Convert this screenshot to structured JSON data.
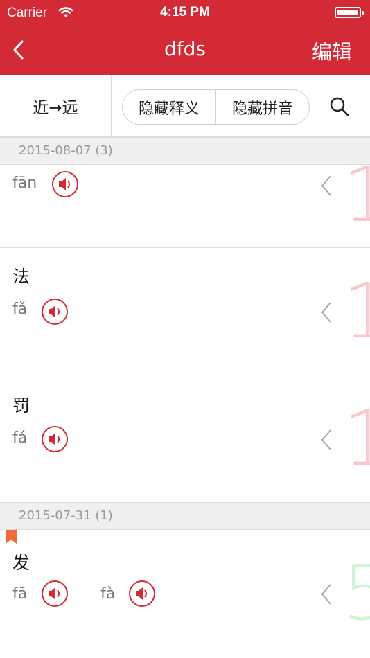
{
  "status": {
    "carrier": "Carrier",
    "time": "4:15 PM"
  },
  "nav": {
    "title": "dfds",
    "edit": "编辑"
  },
  "toolbar": {
    "sort": "近→远",
    "hide_meaning": "隐藏释义",
    "hide_pinyin": "隐藏拼音"
  },
  "sections": [
    {
      "date": "2015-08-07 (3)"
    },
    {
      "date": "2015-07-31 (1)"
    }
  ],
  "rows": [
    {
      "word": "",
      "pinyin": [
        "fān"
      ],
      "number": "1",
      "number_color": "#f7c9cc"
    },
    {
      "word": "法",
      "pinyin": [
        "fǎ"
      ],
      "number": "1",
      "number_color": "#f7c9cc"
    },
    {
      "word": "罚",
      "pinyin": [
        "fá"
      ],
      "number": "1",
      "number_color": "#f7c9cc"
    },
    {
      "word": "发",
      "pinyin": [
        "fā",
        "fà"
      ],
      "number": "5",
      "number_color": "#d3f2d6",
      "bookmarked": true
    }
  ],
  "colors": {
    "accent": "#d42a36",
    "bookmark": "#f26b3a"
  },
  "icons": [
    "wifi-icon",
    "battery-icon",
    "back-chevron-icon",
    "search-icon",
    "speaker-icon",
    "chevron-left-icon",
    "bookmark-icon"
  ]
}
